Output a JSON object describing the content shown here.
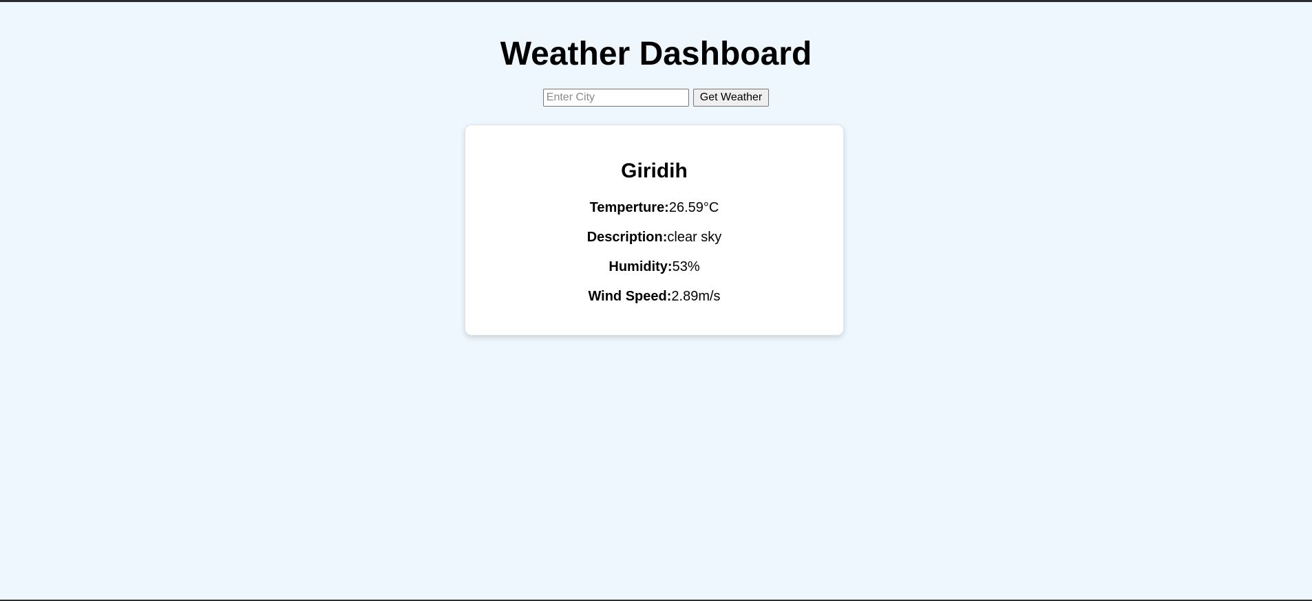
{
  "header": {
    "title": "Weather Dashboard"
  },
  "search": {
    "placeholder": "Enter City",
    "value": "",
    "button_label": "Get Weather"
  },
  "weather": {
    "city": "Giridih",
    "temperature": {
      "label": "Temperture:",
      "value": "26.59°C"
    },
    "description": {
      "label": "Description:",
      "value": "clear sky"
    },
    "humidity": {
      "label": "Humidity:",
      "value": "53%"
    },
    "wind_speed": {
      "label": "Wind Speed:",
      "value": "2.89m/s"
    }
  },
  "colors": {
    "page_background": "#eef6fe",
    "card_background": "#ffffff",
    "button_background": "#efefef"
  }
}
